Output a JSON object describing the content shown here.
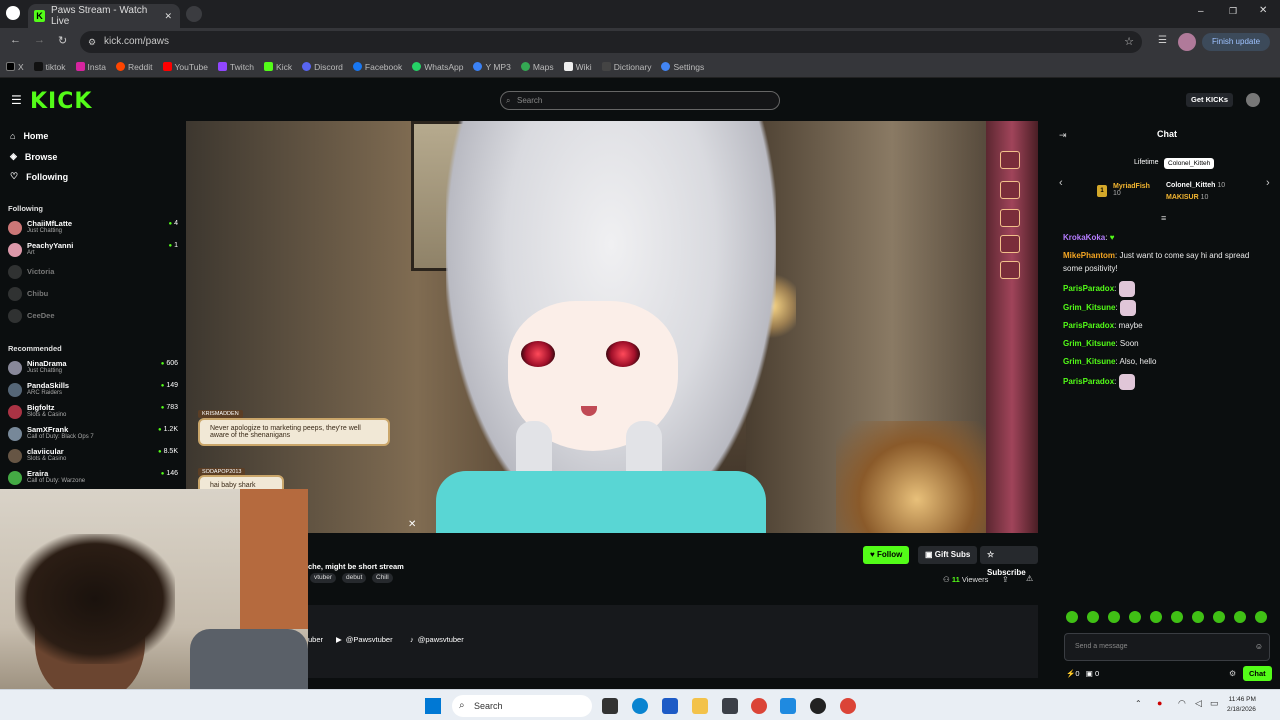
{
  "browser": {
    "tab_title": "Paws Stream - Watch Live",
    "url": "kick.com/paws",
    "update_label": "Finish update",
    "bookmarks": [
      "X",
      "tiktok",
      "Insta",
      "Reddit",
      "YouTube",
      "Twitch",
      "Kick",
      "Discord",
      "Facebook",
      "WhatsApp",
      "Y MP3",
      "Maps",
      "Wiki",
      "Dictionary",
      "Settings"
    ]
  },
  "header": {
    "logo": "KICK",
    "search_placeholder": "Search",
    "get_kicks": "Get KICKs"
  },
  "sidebar": {
    "nav": [
      {
        "label": "Home",
        "icon": "home-icon"
      },
      {
        "label": "Browse",
        "icon": "compass-icon"
      },
      {
        "label": "Following",
        "icon": "heart-icon"
      }
    ],
    "following_title": "Following",
    "following": [
      {
        "name": "ChaiiMfLatte",
        "category": "Just Chatting",
        "viewers": "4",
        "live": true
      },
      {
        "name": "PeachyYanni",
        "category": "Art",
        "viewers": "1",
        "live": true
      },
      {
        "name": "Victoria",
        "live": false
      },
      {
        "name": "Chibu",
        "live": false
      },
      {
        "name": "CeeDee",
        "live": false
      }
    ],
    "recommended_title": "Recommended",
    "recommended": [
      {
        "name": "NinaDrama",
        "category": "Just Chatting",
        "viewers": "606"
      },
      {
        "name": "PandaSkills",
        "category": "ARC Raiders",
        "viewers": "149"
      },
      {
        "name": "Bigfoltz",
        "category": "Slots & Casino",
        "viewers": "783"
      },
      {
        "name": "SamXFrank",
        "category": "Call of Duty: Black Ops 7",
        "viewers": "1.2K"
      },
      {
        "name": "claviicular",
        "category": "Slots & Casino",
        "viewers": "8.5K"
      },
      {
        "name": "Eraira",
        "category": "Call of Duty: Warzone",
        "viewers": "146"
      }
    ]
  },
  "video": {
    "bubble1_name": "KRISMADDEN",
    "bubble1_text": "Never apologize to marketing peeps, they're well aware of the shenanigans",
    "bubble2_name": "SODAPOP2013",
    "bubble2_text": "hai baby shark"
  },
  "stream": {
    "title": "che, might be short stream",
    "tags": [
      "vtuber",
      "debut",
      "Chill"
    ],
    "follow": "Follow",
    "gift": "Gift Subs",
    "subscribe": "Subscribe",
    "viewers_count": "11",
    "viewers_label": "Viewers",
    "socials": [
      "uber",
      "@Pawsvtuber",
      "@pawsvtuber"
    ]
  },
  "chat": {
    "title": "Chat",
    "lifetime": "Lifetime",
    "tooltip": "Colonel_Kitteh",
    "gifters": [
      {
        "name": "MyriadFish",
        "count": "10",
        "color": "#f5b731"
      },
      {
        "name": "Colonel_Kitteh",
        "count": "10",
        "color": "#ffffff"
      },
      {
        "name": "MAKISUR",
        "count": "10",
        "color": "#f5b731"
      }
    ],
    "messages": [
      {
        "user": "KrokaKoka",
        "color": "#b57cff",
        "text": ""
      },
      {
        "user": "MikePhantom",
        "color": "#f5a623",
        "text": "Just want to come say hi and spread some positivity!"
      },
      {
        "user": "ParisParadox",
        "color": "#53fc18",
        "text": ""
      },
      {
        "user": "Grim_Kitsune",
        "color": "#53fc18",
        "text": ""
      },
      {
        "user": "ParisParadox",
        "color": "#53fc18",
        "text": "maybe"
      },
      {
        "user": "Grim_Kitsune",
        "color": "#53fc18",
        "text": "Soon"
      },
      {
        "user": "Grim_Kitsune",
        "color": "#53fc18",
        "text": "Also, hello"
      },
      {
        "user": "ParisParadox",
        "color": "#53fc18",
        "text": ""
      }
    ],
    "input_placeholder": "Send a message",
    "points_a": "0",
    "points_b": "0",
    "send": "Chat"
  },
  "taskbar": {
    "search": "Search",
    "time": "11:46 PM",
    "date": "2/18/2026"
  }
}
